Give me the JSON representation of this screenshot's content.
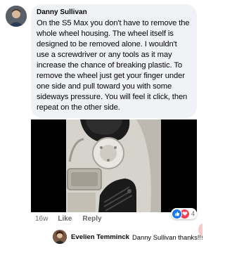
{
  "comment": {
    "author": "Danny Sullivan",
    "text": "On the S5 Max you don't have to remove the whole wheel housing. The wheel itself is designed to be removed alone. I wouldn't use a screwdriver or any tools as it may increase the chance of breaking plastic. To remove the wheel just get your finger under one side and pull toward you with some sideways pressure. You will feel it click, then repeat on the other side.",
    "time": "16w",
    "like_label": "Like",
    "reply_label": "Reply",
    "reactions": {
      "count": "4",
      "icons": [
        "like-reaction-icon",
        "love-reaction-icon"
      ],
      "colors": {
        "like": "#1877f2",
        "love": "#f33e58"
      }
    }
  },
  "reply": {
    "author": "Evelien Temminck",
    "text": "Danny Sullivan thanks!!!"
  },
  "theme": {
    "bubble_bg": "#f0f2f5",
    "meta_color": "#65676b"
  }
}
